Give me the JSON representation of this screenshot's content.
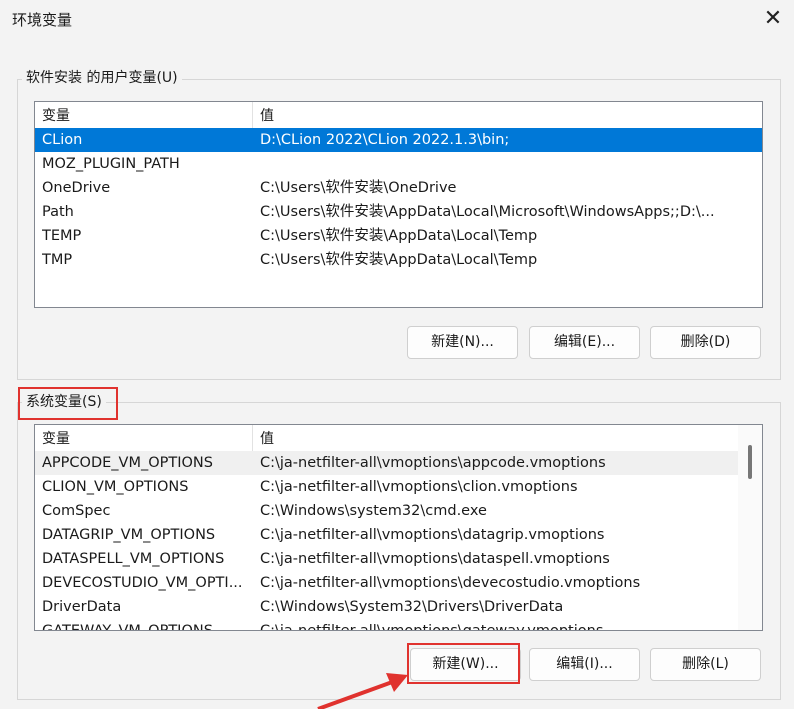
{
  "window": {
    "title": "环境变量",
    "close_symbol": "✕"
  },
  "user_vars": {
    "group_label": "软件安装 的用户变量(U)",
    "columns": [
      "变量",
      "值"
    ],
    "rows": [
      {
        "name": "CLion",
        "value": "D:\\CLion 2022\\CLion 2022.1.3\\bin;",
        "selected": true
      },
      {
        "name": "MOZ_PLUGIN_PATH",
        "value": ""
      },
      {
        "name": "OneDrive",
        "value": "C:\\Users\\软件安装\\OneDrive"
      },
      {
        "name": "Path",
        "value": "C:\\Users\\软件安装\\AppData\\Local\\Microsoft\\WindowsApps;;D:\\..."
      },
      {
        "name": "TEMP",
        "value": "C:\\Users\\软件安装\\AppData\\Local\\Temp"
      },
      {
        "name": "TMP",
        "value": "C:\\Users\\软件安装\\AppData\\Local\\Temp"
      }
    ],
    "buttons": {
      "new": "新建(N)...",
      "edit": "编辑(E)...",
      "delete": "删除(D)"
    }
  },
  "system_vars": {
    "group_label": "系统变量(S)",
    "columns": [
      "变量",
      "值"
    ],
    "rows": [
      {
        "name": "APPCODE_VM_OPTIONS",
        "value": "C:\\ja-netfilter-all\\vmoptions\\appcode.vmoptions"
      },
      {
        "name": "CLION_VM_OPTIONS",
        "value": "C:\\ja-netfilter-all\\vmoptions\\clion.vmoptions"
      },
      {
        "name": "ComSpec",
        "value": "C:\\Windows\\system32\\cmd.exe"
      },
      {
        "name": "DATAGRIP_VM_OPTIONS",
        "value": "C:\\ja-netfilter-all\\vmoptions\\datagrip.vmoptions"
      },
      {
        "name": "DATASPELL_VM_OPTIONS",
        "value": "C:\\ja-netfilter-all\\vmoptions\\dataspell.vmoptions"
      },
      {
        "name": "DEVECOSTUDIO_VM_OPTI...",
        "value": "C:\\ja-netfilter-all\\vmoptions\\devecostudio.vmoptions"
      },
      {
        "name": "DriverData",
        "value": "C:\\Windows\\System32\\Drivers\\DriverData"
      },
      {
        "name": "GATEWAY_VM_OPTIONS",
        "value": "C:\\ja-netfilter-all\\vmoptions\\gateway.vmoptions"
      }
    ],
    "buttons": {
      "new": "新建(W)...",
      "edit": "编辑(I)...",
      "delete": "删除(L)"
    }
  },
  "colors": {
    "selection": "#0078d7",
    "highlight": "#e0322e"
  }
}
